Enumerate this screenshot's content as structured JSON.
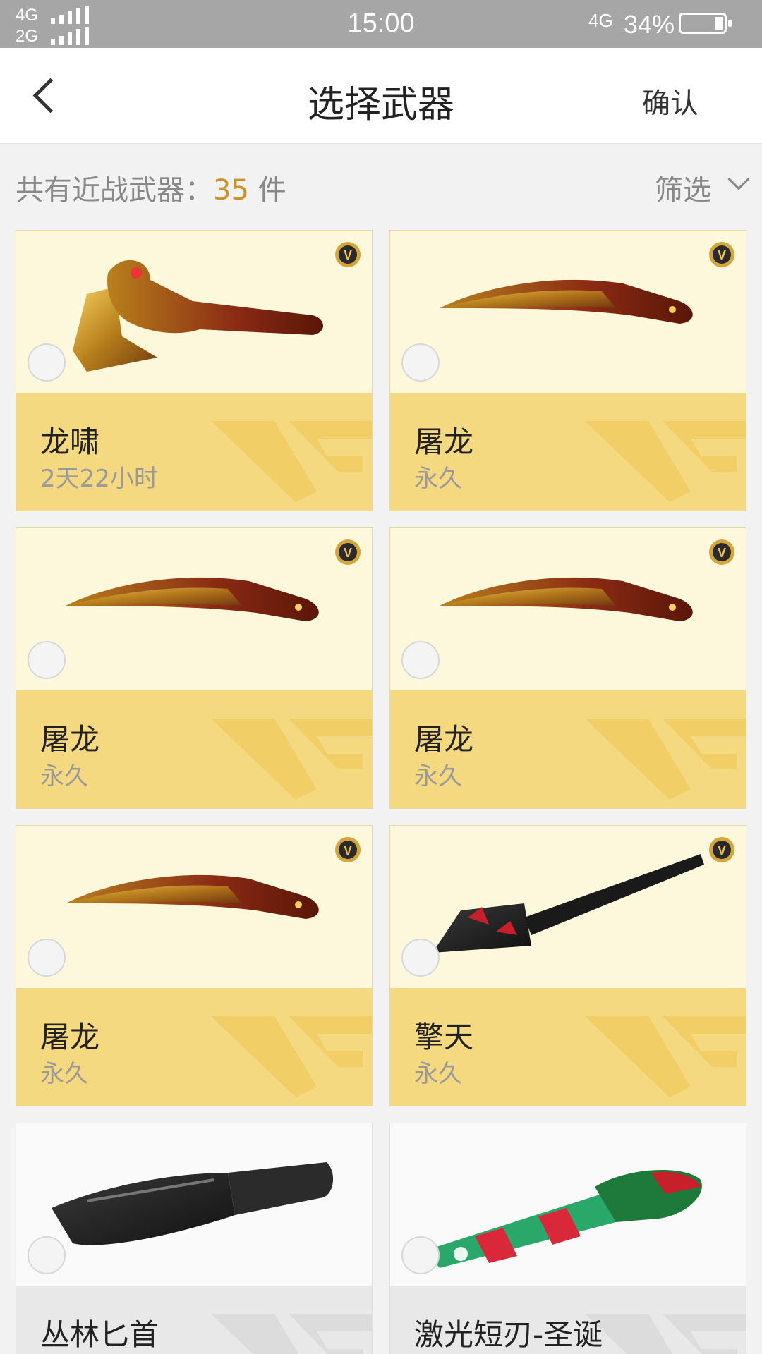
{
  "status_bar": {
    "network_1": "4G",
    "network_2": "2G",
    "time": "15:00",
    "network_right": "4G",
    "battery": "34%"
  },
  "header": {
    "title": "选择武器",
    "confirm": "确认"
  },
  "summary": {
    "label": "共有近战武器：",
    "count": "35",
    "unit": " 件",
    "filter": "筛选"
  },
  "weapons": [
    {
      "name": "龙啸",
      "duration": "2天22小时",
      "vip": true,
      "weapon": "dragon-axe-icon"
    },
    {
      "name": "屠龙",
      "duration": "永久",
      "vip": true,
      "weapon": "dragon-kukri-icon"
    },
    {
      "name": "屠龙",
      "duration": "永久",
      "vip": true,
      "weapon": "dragon-kukri-icon"
    },
    {
      "name": "屠龙",
      "duration": "永久",
      "vip": true,
      "weapon": "dragon-kukri-icon"
    },
    {
      "name": "屠龙",
      "duration": "永久",
      "vip": true,
      "weapon": "dragon-kukri-icon"
    },
    {
      "name": "擎天",
      "duration": "永久",
      "vip": true,
      "weapon": "black-spade-icon"
    },
    {
      "name": "丛林匕首",
      "duration": "",
      "vip": false,
      "weapon": "jungle-knife-icon"
    },
    {
      "name": "激光短刃-圣诞",
      "duration": "",
      "vip": false,
      "weapon": "christmas-laser-blade-icon"
    }
  ],
  "colors": {
    "accent": "#c9932a",
    "card_gold": "#f5d980",
    "card_light": "#fdf8dc",
    "status_bar": "#a6a6a6"
  }
}
